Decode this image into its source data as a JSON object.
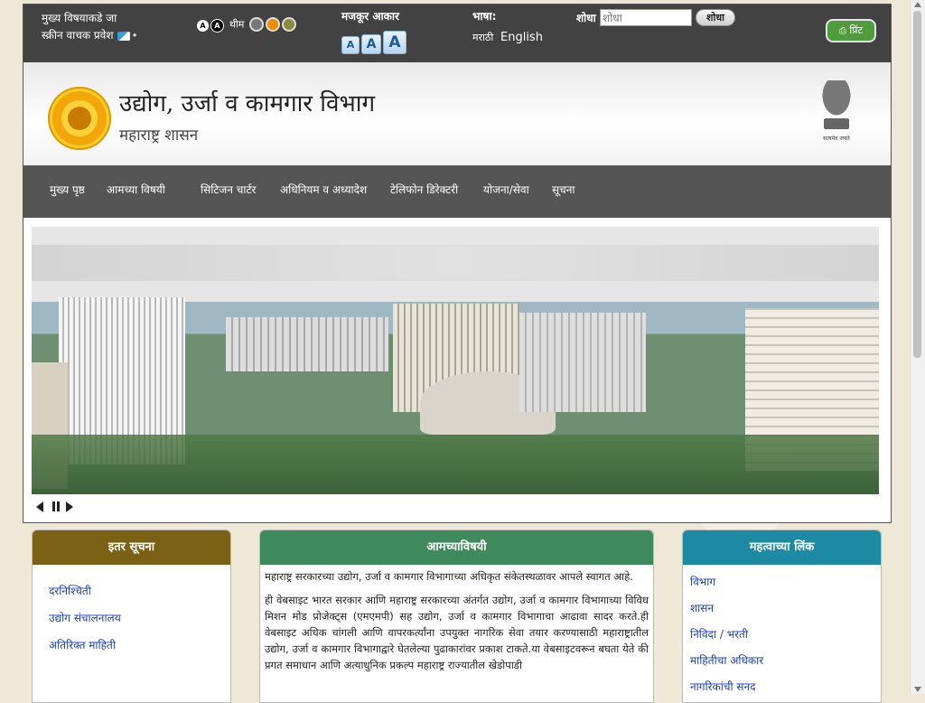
{
  "topbar": {
    "skip_main": "मुख्य विषयाकडे जा",
    "screen_reader": "स्क्रीन वाचक प्रवेश",
    "contrast_a": "A",
    "contrast_b": "A",
    "theme_label": "थीम",
    "theme_colors": [
      "#777777",
      "#f28b00",
      "#8a8a3a"
    ],
    "text_size_label": "मजकूर आकार",
    "text_size_small": "A",
    "text_size_normal": "A",
    "text_size_large": "A",
    "language_label": "भाषा:",
    "lang_marathi": "मराठी",
    "lang_english": "English",
    "search_label": "शोधा",
    "search_placeholder": "शोधा",
    "search_button": "शोधा",
    "print_label": "प्रिंट"
  },
  "header": {
    "title": "उद्योग, उर्जा व कामगार विभाग",
    "subtitle": "महाराष्ट्र शासन",
    "emblem_motto": "सत्यमेव जयते"
  },
  "nav": {
    "items": [
      "मुख्य पृष्ठ",
      "आमच्या विषयी",
      "सिटिजन चार्टर",
      "अधिनियम व अध्यादेश",
      "टेलिफोन डिरेक्टरी",
      "योजना/सेवा",
      "सूचना"
    ]
  },
  "left_panel": {
    "title": "इतर सूचना",
    "items": [
      "दरनिश्चिती",
      "उद्योग संचालनालय",
      "अतिरिक्त माहिती"
    ]
  },
  "mid_panel": {
    "title": "आमच्याविषयी",
    "para1": "महाराष्ट्र सरकारच्या उद्योग, उर्जा व कामगार विभागाच्या अधिकृत संकेतस्थळावर आपले स्वागत आहे.",
    "para2": "ही वेबसाइट भारत सरकार आणि महाराष्ट्र सरकारच्या अंतर्गत उद्योग, उर्जा व कामगार विभागाच्या विविध मिशन मोड प्रोजेक्ट्स (एमएमपी) सह उद्योग, उर्जा व कामगार विभागाचा आढावा सादर करते.ही वेबसाइट अधिक चांगली आणि वापरकर्त्यांना उपयुक्त नागरिक सेवा तयार करण्यासाठी महाराष्ट्रातील उद्योग, उर्जा व कामगार विभागाद्वारे घेतलेल्या पुढाकारांवर प्रकाश टाकते.या वेबसाइटवरून बघता येते की प्रगत समाधान आणि अत्याधुनिक प्रकल्प महाराष्ट्र राज्यातील खेडोपाडी"
  },
  "right_panel": {
    "title": "महत्वाच्या लिंक",
    "items": [
      "विभाग",
      "शासन",
      "निविदा / भरती",
      "माहितीचा अधिकार",
      "नागरिकांची सनद"
    ]
  }
}
